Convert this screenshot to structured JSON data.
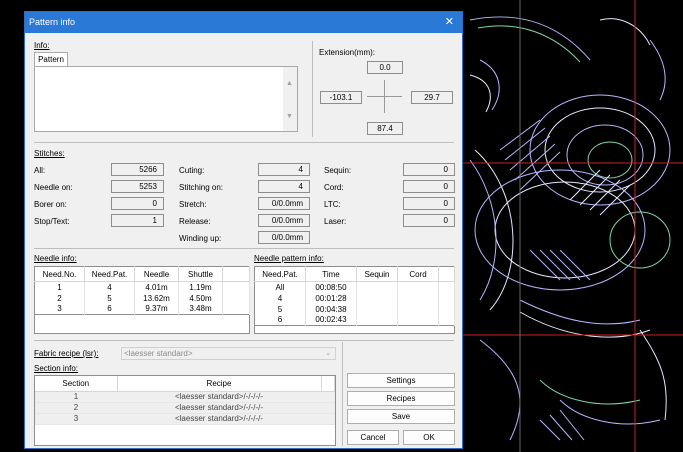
{
  "window": {
    "title": "Pattern info",
    "close_glyph": "✕"
  },
  "info": {
    "label": "Info:",
    "tab": "Pattern",
    "memo": "",
    "scroll_up": "▲",
    "scroll_down": "▼"
  },
  "extension": {
    "label": "Extension(mm):",
    "top": "0.0",
    "left": "-103.1",
    "right": "29.7",
    "bottom": "87.4"
  },
  "stitches": {
    "label": "Stitches:",
    "col1": [
      {
        "label": "All:",
        "value": "5266"
      },
      {
        "label": "Needle on:",
        "value": "5253"
      },
      {
        "label": "Borer on:",
        "value": "0"
      },
      {
        "label": "Stop/Text:",
        "value": "1"
      }
    ],
    "col2": [
      {
        "label": "Cuting:",
        "value": "4"
      },
      {
        "label": "Stitching on:",
        "value": "4"
      },
      {
        "label": "Stretch:",
        "value": "0/0.0mm"
      },
      {
        "label": "Release:",
        "value": "0/0.0mm"
      },
      {
        "label": "Winding up:",
        "value": "0/0.0mm"
      }
    ],
    "col3": [
      {
        "label": "Sequin:",
        "value": "0"
      },
      {
        "label": "Cord:",
        "value": "0"
      },
      {
        "label": "LTC:",
        "value": "0"
      },
      {
        "label": "Laser:",
        "value": "0"
      }
    ]
  },
  "needle_info": {
    "label": "Needle info:",
    "columns": [
      "Need.No.",
      "Need.Pat.",
      "Needle",
      "Shuttle"
    ],
    "rows": [
      [
        "1",
        "4",
        "4.01m",
        "1.19m"
      ],
      [
        "2",
        "5",
        "13.62m",
        "4.50m"
      ],
      [
        "3",
        "6",
        "9.37m",
        "3.48m"
      ]
    ]
  },
  "needle_pattern_info": {
    "label": "Needle pattern info:",
    "columns": [
      "Need.Pat.",
      "Time",
      "Sequin",
      "Cord"
    ],
    "rows": [
      [
        "All",
        "00:08:50",
        "",
        ""
      ],
      [
        "4",
        "00:01:28",
        "",
        ""
      ],
      [
        "5",
        "00:04:38",
        "",
        ""
      ],
      [
        "6",
        "00:02:43",
        "",
        ""
      ]
    ]
  },
  "fabric_recipe": {
    "label": "Fabric recipe (lsr):",
    "value": "<laesser standard>",
    "arrow": "⌄"
  },
  "section_info": {
    "label": "Section info:",
    "columns": [
      "Section",
      "Recipe"
    ],
    "rows": [
      [
        "1",
        "<laesser standard>/-/-/-/-"
      ],
      [
        "2",
        "<laesser standard>/-/-/-/-"
      ],
      [
        "3",
        "<laesser standard>/-/-/-/-"
      ]
    ]
  },
  "buttons": {
    "settings": "Settings",
    "recipes": "Recipes",
    "save": "Save",
    "cancel": "Cancel",
    "ok": "OK"
  },
  "colors": {
    "titlebar": "#2b79d6",
    "dialog_bg": "#f0f0f0",
    "canvas_bg": "#000000",
    "stitch_lavender": "#b7b6ff",
    "stitch_white": "#e8e8ff",
    "stitch_green": "#7fd6a8",
    "guide_red": "#d02020"
  }
}
